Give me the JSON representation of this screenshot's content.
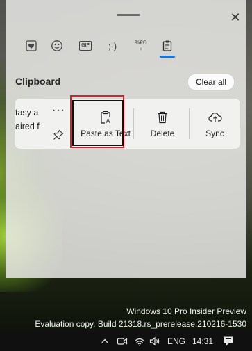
{
  "panel": {
    "tabs": [
      {
        "name": "heart-emoji-icon"
      },
      {
        "name": "smiley-icon"
      },
      {
        "name": "gif-icon",
        "label": "GIF"
      },
      {
        "name": "kaomoji-icon",
        "label": ";-)"
      },
      {
        "name": "symbols-icon",
        "label": "%€Ω+"
      },
      {
        "name": "clipboard-icon",
        "active": true
      }
    ],
    "section_title": "Clipboard",
    "clear_all_label": "Clear all",
    "clip_item": {
      "text_line1": "tasy a",
      "text_line2": "aired f",
      "more_label": "···",
      "actions": [
        {
          "label": "Paste as Text",
          "icon": "paste-as-text-icon"
        },
        {
          "label": "Delete",
          "icon": "trash-icon"
        },
        {
          "label": "Sync",
          "icon": "cloud-upload-icon"
        }
      ]
    },
    "close_label": "✕"
  },
  "watermark": {
    "line1": "Windows 10 Pro Insider Preview",
    "line2": "Evaluation copy. Build 21318.rs_prerelease.210216-1530"
  },
  "taskbar": {
    "language": "ENG",
    "time": "14:31"
  },
  "colors": {
    "accent": "#1a73d9",
    "highlight_red": "#e01e28"
  }
}
